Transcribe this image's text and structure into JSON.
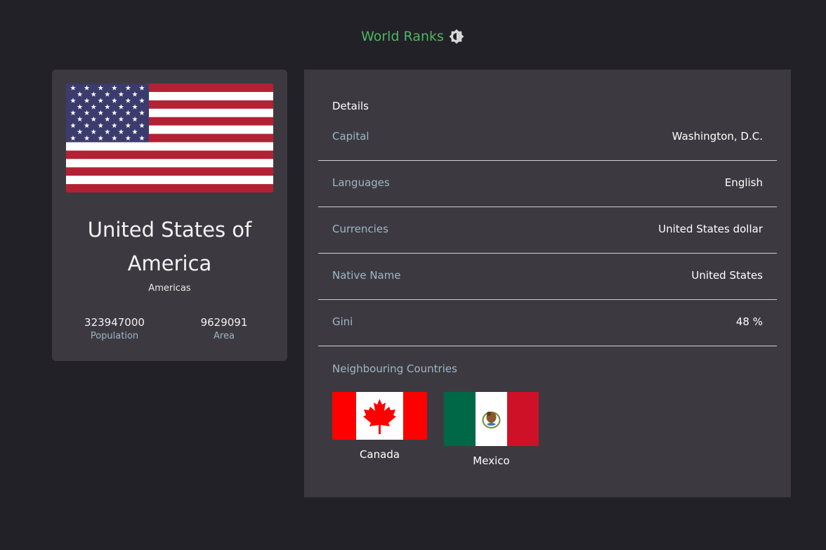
{
  "header": {
    "brand": "World Ranks",
    "theme_icon": "half-circle-gear-icon"
  },
  "country": {
    "name": "United States of America",
    "region": "Americas",
    "flag_icon": "usa-flag",
    "population": "323947000",
    "population_label": "Population",
    "area": "9629091",
    "area_label": "Area"
  },
  "details": {
    "title": "Details",
    "rows": [
      {
        "label": "Capital",
        "value": "Washington, D.C."
      },
      {
        "label": "Languages",
        "value": "English"
      },
      {
        "label": "Currencies",
        "value": "United States dollar"
      },
      {
        "label": "Native Name",
        "value": "United States"
      },
      {
        "label": "Gini",
        "value": "48 %"
      }
    ]
  },
  "neighbours": {
    "title": "Neighbouring Countries",
    "items": [
      {
        "name": "Canada",
        "flag_icon": "canada-flag"
      },
      {
        "name": "Mexico",
        "flag_icon": "mexico-flag"
      }
    ]
  },
  "colors": {
    "background": "#232128",
    "panel": "#3c3a40",
    "accent": "#4cb85f",
    "label": "#9fb6c6"
  }
}
